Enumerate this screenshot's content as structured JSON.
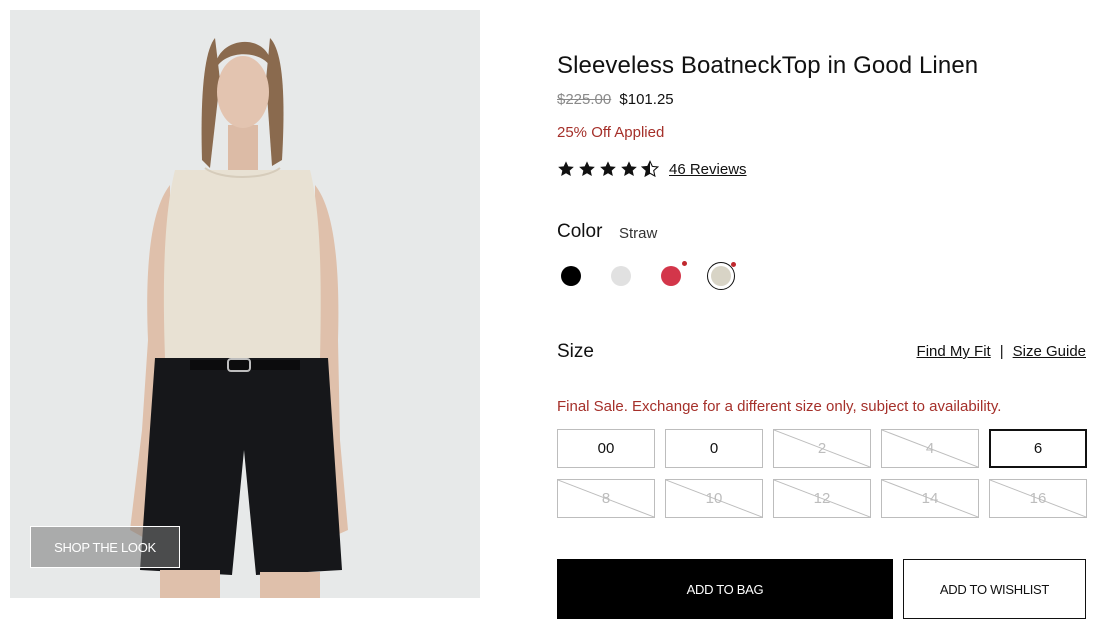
{
  "image": {
    "shop_the_look": "SHOP THE LOOK"
  },
  "product": {
    "title": "Sleeveless BoatneckTop in Good Linen",
    "price_original": "$225.00",
    "price_sale": "$101.25",
    "discount": "25% Off Applied",
    "rating": 4.5,
    "rating_max": 5,
    "reviews": "46 Reviews"
  },
  "color": {
    "label": "Color",
    "selected": "Straw",
    "swatches": [
      {
        "name": "black",
        "hex": "#000000",
        "dot": false
      },
      {
        "name": "light-gray",
        "hex": "#e1e1e1",
        "dot": false
      },
      {
        "name": "red",
        "hex": "#d3364a",
        "dot": true
      },
      {
        "name": "straw",
        "hex": "#d8d4c6",
        "dot": true,
        "selected": true
      }
    ]
  },
  "size": {
    "label": "Size",
    "find_my_fit": "Find My Fit",
    "separator": "|",
    "size_guide": "Size Guide",
    "final_sale": "Final Sale. Exchange for a different size only, subject to availability.",
    "options": [
      {
        "label": "00",
        "available": true
      },
      {
        "label": "0",
        "available": true
      },
      {
        "label": "2",
        "available": false
      },
      {
        "label": "4",
        "available": false
      },
      {
        "label": "6",
        "available": true,
        "selected": true
      },
      {
        "label": "8",
        "available": false
      },
      {
        "label": "10",
        "available": false
      },
      {
        "label": "12",
        "available": false
      },
      {
        "label": "14",
        "available": false
      },
      {
        "label": "16",
        "available": false
      }
    ]
  },
  "actions": {
    "add_to_bag": "ADD TO BAG",
    "add_to_wishlist": "ADD TO WISHLIST"
  }
}
